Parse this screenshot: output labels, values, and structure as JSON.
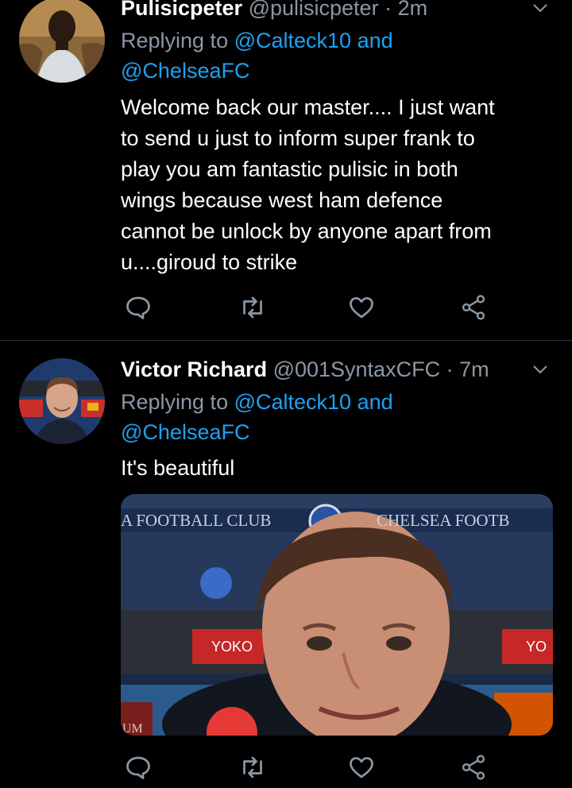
{
  "tweets": [
    {
      "name": "Pulisicpeter",
      "handle": "@pulisicpeter",
      "dot": "·",
      "time": "2m",
      "replying_prefix": "Replying to ",
      "mention1": "@Calteck10",
      "and": " and",
      "mention2": "@ChelseaFC",
      "body_lines": [
        "Welcome back our master.... I just want",
        "to send u just to inform super frank to",
        "play you am fantastic pulisic in both",
        "wings because west ham defence",
        "cannot be unlock by anyone apart from",
        "u....giroud to strike"
      ]
    },
    {
      "name": "Victor Richard",
      "handle": "@001SyntaxCFC",
      "dot": "·",
      "time": "7m",
      "replying_prefix": "Replying to ",
      "mention1": "@Calteck10",
      "and": " and",
      "mention2": "@ChelseaFC",
      "body_lines": [
        "It's beautiful"
      ],
      "media_texts": {
        "board_left": "A FOOTBALL CLUB",
        "board_right": "CHELSEA FOOTB",
        "sponsor_left": "YOKO",
        "sponsor_right": "YO",
        "bottom_left": "UM"
      }
    }
  ],
  "icons": [
    "reply-icon",
    "retweet-icon",
    "like-icon",
    "share-icon",
    "chevron-down-icon"
  ],
  "colors": {
    "background": "#000000",
    "accent": "#1da1f2",
    "secondary_text": "#8b98a5",
    "divider": "#2f3336"
  }
}
